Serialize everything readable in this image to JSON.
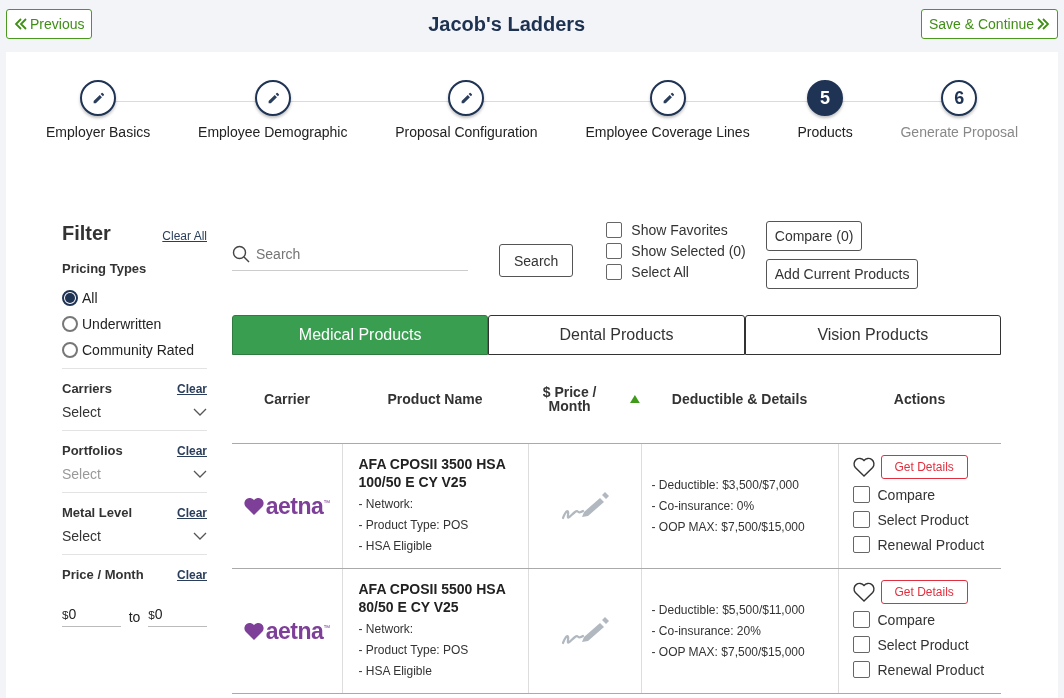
{
  "header": {
    "previous": "Previous",
    "title": "Jacob's Ladders",
    "save": "Save & Continue"
  },
  "steps": [
    {
      "label": "Employer Basics",
      "completed": true,
      "current": false
    },
    {
      "label": "Employee Demographic",
      "completed": true,
      "current": false
    },
    {
      "label": "Proposal Configuration",
      "completed": true,
      "current": false
    },
    {
      "label": "Employee Coverage Lines",
      "completed": true,
      "current": false
    },
    {
      "label": "Products",
      "completed": false,
      "current": true,
      "number": "5"
    },
    {
      "label": "Generate Proposal",
      "completed": false,
      "current": false,
      "number": "6"
    }
  ],
  "filter": {
    "title": "Filter",
    "clear_all": "Clear All",
    "pricing_title": "Pricing Types",
    "pricing_types": [
      {
        "label": "All",
        "selected": true
      },
      {
        "label": "Underwritten",
        "selected": false
      },
      {
        "label": "Community Rated",
        "selected": false
      }
    ],
    "dropdowns": [
      {
        "label": "Carriers",
        "clear": "Clear",
        "value": "Select",
        "disabled": false
      },
      {
        "label": "Portfolios",
        "clear": "Clear",
        "value": "Select",
        "disabled": true
      },
      {
        "label": "Metal Level",
        "clear": "Clear",
        "value": "Select",
        "disabled": false
      }
    ],
    "price": {
      "label": "Price / Month",
      "clear": "Clear",
      "currency_from": "$",
      "from": "0",
      "to_label": "to",
      "currency_to": "$",
      "to": "0"
    }
  },
  "toolbar": {
    "search_placeholder": "Search",
    "search_button": "Search",
    "checks": [
      {
        "label": "Show Favorites",
        "checked": false
      },
      {
        "label": "Show Selected (0)",
        "checked": false
      },
      {
        "label": "Select All",
        "checked": false
      }
    ],
    "compare": "Compare (0)",
    "add_current": "Add Current Products"
  },
  "tabs": [
    {
      "label": "Medical Products",
      "selected": true
    },
    {
      "label": "Dental Products",
      "selected": false
    },
    {
      "label": "Vision Products",
      "selected": false
    }
  ],
  "table": {
    "columns": [
      "Carrier",
      "Product Name",
      "$ Price / Month",
      "Deductible & Details",
      "Actions"
    ],
    "sort_ascending": true,
    "rows": [
      {
        "carrier": "aetna$^{™}$",
        "name": "AFA CPOSII 3500 HSA 100/50 E CY V25",
        "info": [
          "- Network:",
          "- Product Type: POS",
          "- HSA Eligible"
        ],
        "details": [
          "- Deductible: $3,500/$7,000",
          "- Co-insurance: 0%",
          "- OOP MAX: $7,500/$15,000"
        ],
        "favorite": false,
        "get_details": "Get Details",
        "actions": [
          {
            "label": "Compare",
            "checked": false
          },
          {
            "label": "Select Product",
            "checked": false
          },
          {
            "label": "Renewal Product",
            "checked": false
          }
        ]
      },
      {
        "carrier": "aetna$^{™}$",
        "name": "AFA CPOSII 5500 HSA 80/50 E CY V25",
        "info": [
          "- Network:",
          "- Product Type: POS",
          "- HSA Eligible"
        ],
        "details": [
          "- Deductible: $5,500/$11,000",
          "- Co-insurance: 20%",
          "- OOP MAX: $7,500/$15,000"
        ],
        "favorite": false,
        "get_details": "Get Details",
        "actions": [
          {
            "label": "Compare",
            "checked": false
          },
          {
            "label": "Select Product",
            "checked": false
          },
          {
            "label": "Renewal Product",
            "checked": false
          }
        ]
      }
    ]
  }
}
